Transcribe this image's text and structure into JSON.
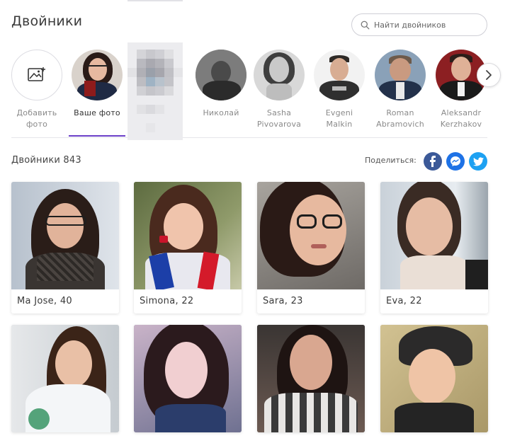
{
  "header": {
    "title": "Двойники",
    "search_placeholder": "Найти двойников"
  },
  "rail": {
    "items": [
      {
        "label_line1": "Добавить",
        "label_line2": "фото"
      },
      {
        "label_line1": "Ваше фото",
        "label_line2": ""
      },
      {
        "label_line1": "Николай",
        "label_line2": ""
      },
      {
        "label_line1": "Sasha",
        "label_line2": "Pivovarova"
      },
      {
        "label_line1": "Evgeni",
        "label_line2": "Malkin"
      },
      {
        "label_line1": "Roman",
        "label_line2": "Abramovich"
      },
      {
        "label_line1": "Aleksandr",
        "label_line2": "Kerzhakov"
      }
    ]
  },
  "results": {
    "count_label": "Двойники 843",
    "share_label": "Поделиться:",
    "share": [
      "facebook-icon",
      "messenger-icon",
      "twitter-icon"
    ],
    "cards": [
      {
        "caption": "Ma Jose, 40"
      },
      {
        "caption": "Simona, 22"
      },
      {
        "caption": "Sara, 23"
      },
      {
        "caption": "Eva, 22"
      },
      {
        "caption": ""
      },
      {
        "caption": ""
      },
      {
        "caption": ""
      },
      {
        "caption": ""
      }
    ]
  },
  "colors": {
    "accent": "#6b3fc8",
    "facebook": "#3b5998",
    "messenger": "#1e72e6",
    "twitter": "#1da1f2"
  }
}
